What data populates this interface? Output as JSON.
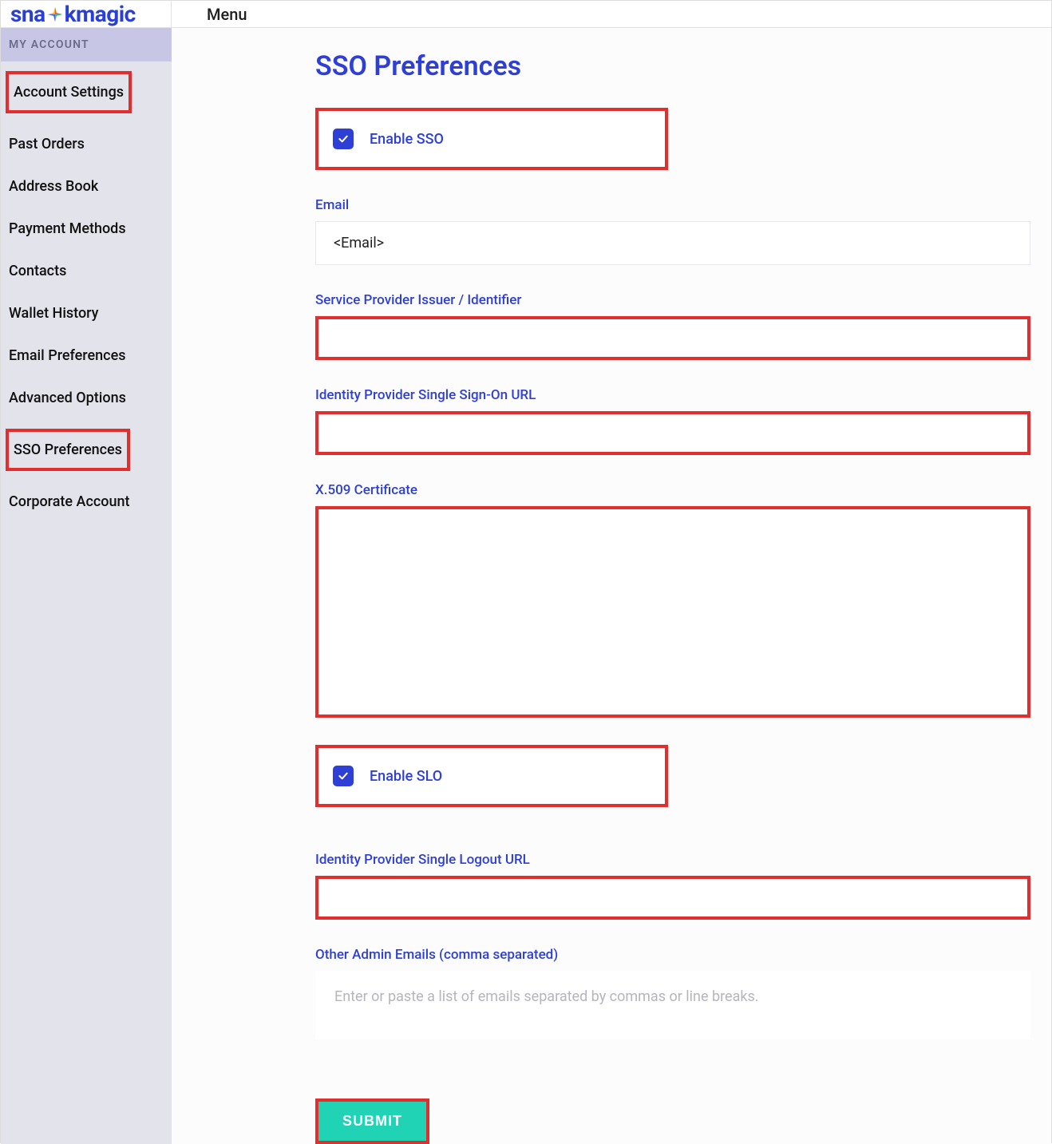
{
  "topbar": {
    "logo_pre": "sna",
    "logo_post": "kmagic",
    "menu_label": "Menu"
  },
  "sidebar": {
    "header": "MY ACCOUNT",
    "items": [
      {
        "label": "Account Settings",
        "highlight": true
      },
      {
        "label": "Past Orders",
        "highlight": false
      },
      {
        "label": "Address Book",
        "highlight": false
      },
      {
        "label": "Payment Methods",
        "highlight": false
      },
      {
        "label": "Contacts",
        "highlight": false
      },
      {
        "label": "Wallet History",
        "highlight": false
      },
      {
        "label": "Email Preferences",
        "highlight": false
      },
      {
        "label": "Advanced Options",
        "highlight": false
      },
      {
        "label": "SSO Preferences",
        "highlight": true
      },
      {
        "label": "Corporate Account",
        "highlight": false
      }
    ]
  },
  "page": {
    "title": "SSO Preferences",
    "enable_sso_label": "Enable SSO",
    "enable_sso_checked": true,
    "email_label": "Email",
    "email_value": "<Email>",
    "sp_issuer_label": "Service Provider Issuer / Identifier",
    "sp_issuer_value": "",
    "idp_sso_url_label": "Identity Provider Single Sign-On URL",
    "idp_sso_url_value": "",
    "x509_label": "X.509 Certificate",
    "x509_value": "",
    "enable_slo_label": "Enable SLO",
    "enable_slo_checked": true,
    "idp_slo_url_label": "Identity Provider Single Logout URL",
    "idp_slo_url_value": "",
    "admin_emails_label": "Other Admin Emails (comma separated)",
    "admin_emails_placeholder": "Enter or paste a list of emails separated by commas or line breaks.",
    "admin_emails_value": "",
    "submit_label": "SUBMIT"
  }
}
